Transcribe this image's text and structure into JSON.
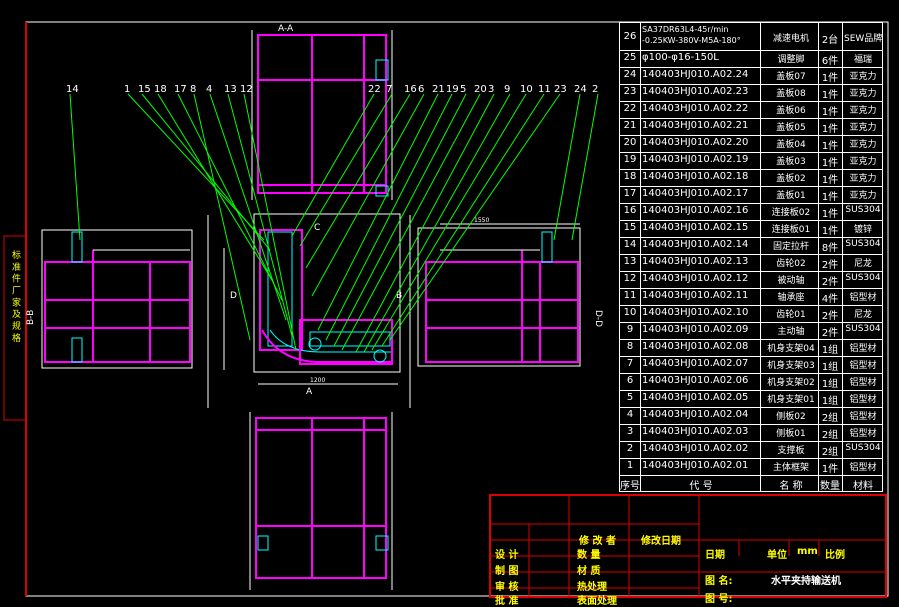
{
  "views": {
    "top_label": "A-A",
    "left_label": "B-B",
    "right_label": "D-D",
    "arrow_c": "C",
    "arrow_d": "D",
    "arrow_b": "B",
    "arrow_a": "A",
    "dim_left": "1550",
    "dim_width": "1200"
  },
  "balloons": [
    "14",
    "1",
    "15",
    "18",
    "17",
    "8",
    "4",
    "13",
    "12",
    "22",
    "7",
    "16",
    "6",
    "21",
    "19",
    "5",
    "20",
    "3",
    "9",
    "10",
    "11",
    "23",
    "24",
    "2"
  ],
  "side_strip": "标 准 件 厂 家 及 规 格",
  "bom": {
    "headers": {
      "no": "序号",
      "code": "代 号",
      "name": "名 称",
      "qty": "数量",
      "mat": "材料"
    },
    "rows": [
      {
        "no": "26",
        "code": "SA37DR63L4-45r/min -0.25KW-380V-M5A-180°",
        "name": "减速电机",
        "qty": "2台",
        "mat": "SEW品牌"
      },
      {
        "no": "25",
        "code": "φ100-φ16-150L",
        "name": "调整脚",
        "qty": "6件",
        "mat": "福瑞"
      },
      {
        "no": "24",
        "code": "140403HJ010.A02.24",
        "name": "盖板07",
        "qty": "1件",
        "mat": "亚克力"
      },
      {
        "no": "23",
        "code": "140403HJ010.A02.23",
        "name": "盖板08",
        "qty": "1件",
        "mat": "亚克力"
      },
      {
        "no": "22",
        "code": "140403HJ010.A02.22",
        "name": "盖板06",
        "qty": "1件",
        "mat": "亚克力"
      },
      {
        "no": "21",
        "code": "140403HJ010.A02.21",
        "name": "盖板05",
        "qty": "1件",
        "mat": "亚克力"
      },
      {
        "no": "20",
        "code": "140403HJ010.A02.20",
        "name": "盖板04",
        "qty": "1件",
        "mat": "亚克力"
      },
      {
        "no": "19",
        "code": "140403HJ010.A02.19",
        "name": "盖板03",
        "qty": "1件",
        "mat": "亚克力"
      },
      {
        "no": "18",
        "code": "140403HJ010.A02.18",
        "name": "盖板02",
        "qty": "1件",
        "mat": "亚克力"
      },
      {
        "no": "17",
        "code": "140403HJ010.A02.17",
        "name": "盖板01",
        "qty": "1件",
        "mat": "亚克力"
      },
      {
        "no": "16",
        "code": "140403HJ010.A02.16",
        "name": "连接板02",
        "qty": "1件",
        "mat": "SUS304"
      },
      {
        "no": "15",
        "code": "140403HJ010.A02.15",
        "name": "连接板01",
        "qty": "1件",
        "mat": "镀锌"
      },
      {
        "no": "14",
        "code": "140403HJ010.A02.14",
        "name": "固定拉杆",
        "qty": "8件",
        "mat": "SUS304"
      },
      {
        "no": "13",
        "code": "140403HJ010.A02.13",
        "name": "齿轮02",
        "qty": "2件",
        "mat": "尼龙"
      },
      {
        "no": "12",
        "code": "140403HJ010.A02.12",
        "name": "被动轴",
        "qty": "2件",
        "mat": "SUS304"
      },
      {
        "no": "11",
        "code": "140403HJ010.A02.11",
        "name": "轴承座",
        "qty": "4件",
        "mat": "铝型材"
      },
      {
        "no": "10",
        "code": "140403HJ010.A02.10",
        "name": "齿轮01",
        "qty": "2件",
        "mat": "尼龙"
      },
      {
        "no": "9",
        "code": "140403HJ010.A02.09",
        "name": "主动轴",
        "qty": "2件",
        "mat": "SUS304"
      },
      {
        "no": "8",
        "code": "140403HJ010.A02.08",
        "name": "机身支架04",
        "qty": "1组",
        "mat": "铝型材"
      },
      {
        "no": "7",
        "code": "140403HJ010.A02.07",
        "name": "机身支架03",
        "qty": "1组",
        "mat": "铝型材"
      },
      {
        "no": "6",
        "code": "140403HJ010.A02.06",
        "name": "机身支架02",
        "qty": "1组",
        "mat": "铝型材"
      },
      {
        "no": "5",
        "code": "140403HJ010.A02.05",
        "name": "机身支架01",
        "qty": "1组",
        "mat": "铝型材"
      },
      {
        "no": "4",
        "code": "140403HJ010.A02.04",
        "name": "侧板02",
        "qty": "2组",
        "mat": "铝型材"
      },
      {
        "no": "3",
        "code": "140403HJ010.A02.03",
        "name": "侧板01",
        "qty": "2组",
        "mat": "铝型材"
      },
      {
        "no": "2",
        "code": "140403HJ010.A02.02",
        "name": "支撑板",
        "qty": "2组",
        "mat": "SUS304"
      },
      {
        "no": "1",
        "code": "140403HJ010.A02.01",
        "name": "主体框架",
        "qty": "1件",
        "mat": "铝型材"
      }
    ]
  },
  "title_block": {
    "change_label": "修 改 者",
    "change_date": "修改日期",
    "design": "设 计",
    "quantity": "数 量",
    "date": "日期",
    "unit": "单位",
    "unit_val": "mm",
    "scale": "比例",
    "draw": "制 图",
    "material": "材 质",
    "review": "审 核",
    "heat": "热处理",
    "approve": "批 准",
    "surface": "表面处理",
    "drawing_name_label": "图 名:",
    "drawing_name": "水平夹持输送机",
    "drawing_no_label": "图 号:"
  }
}
